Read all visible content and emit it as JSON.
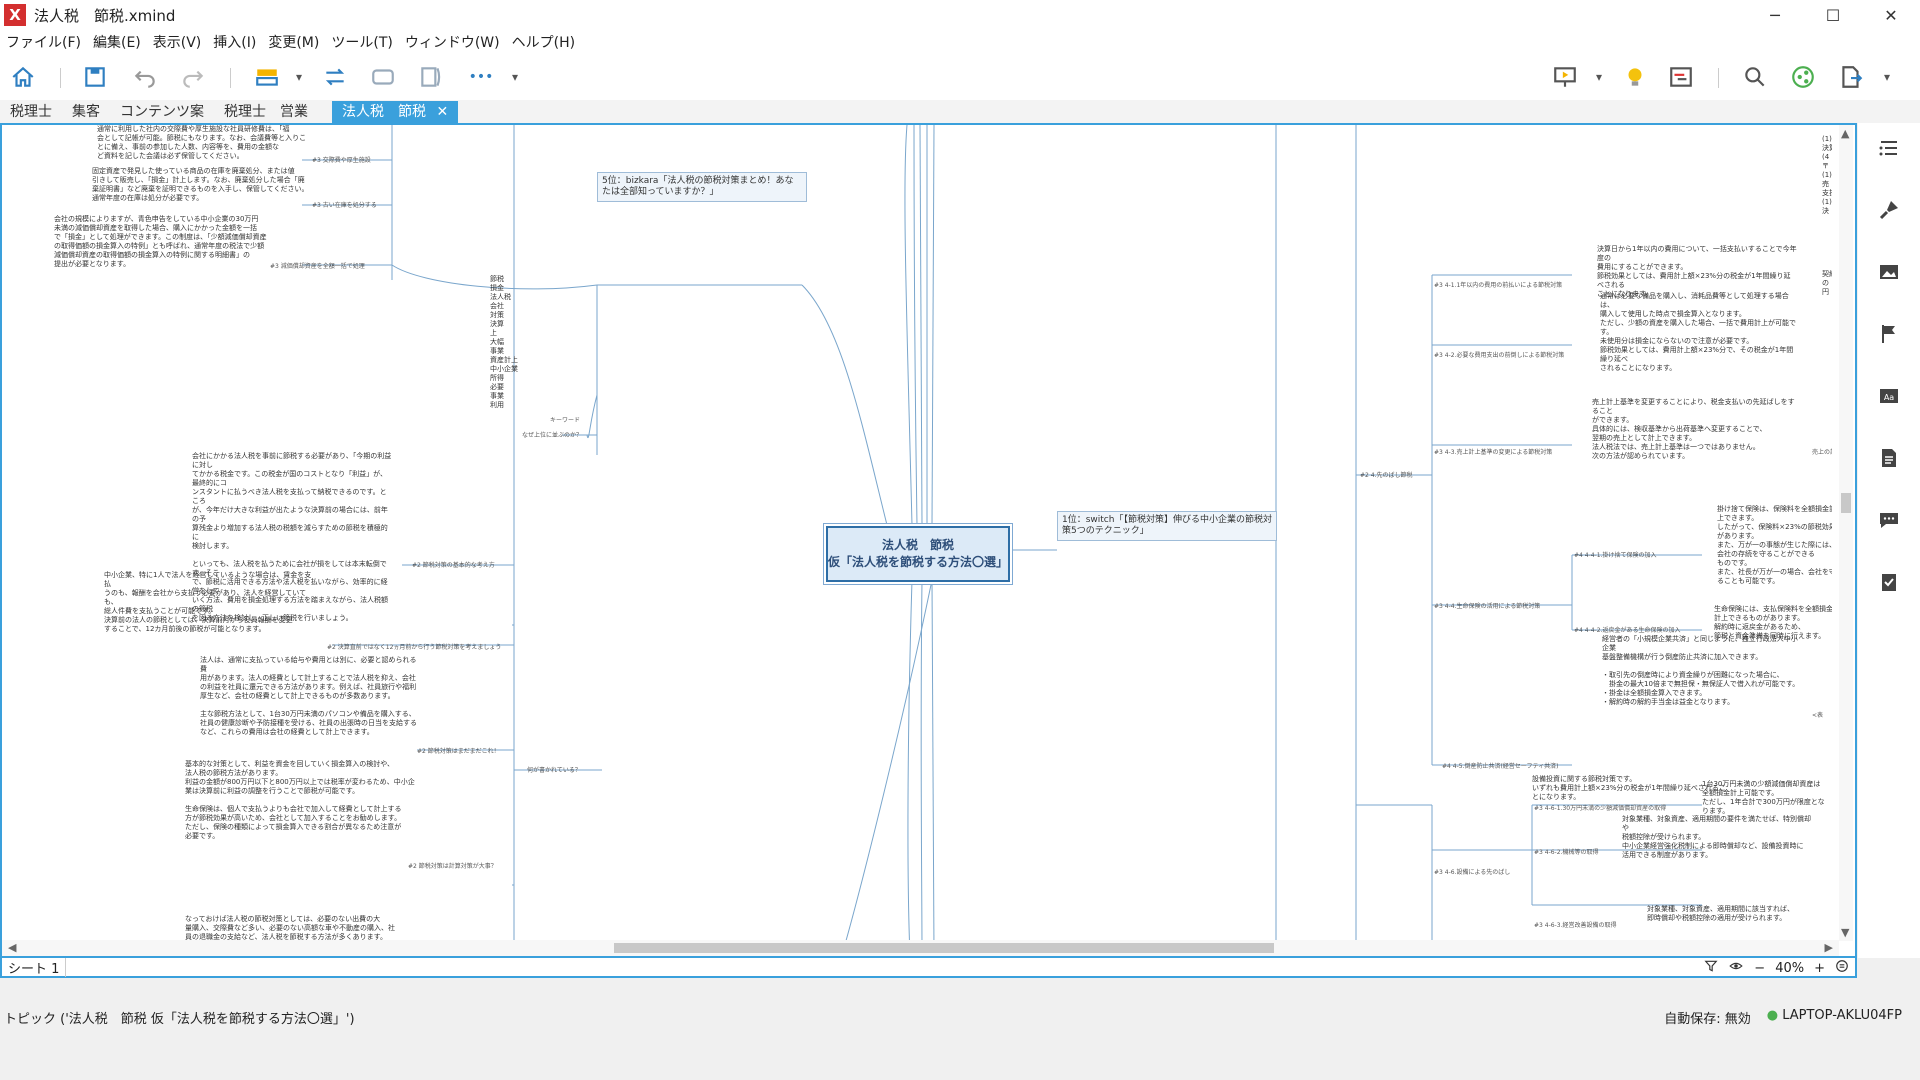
{
  "window": {
    "title": "法人税　節税.xmind",
    "app_icon": "X",
    "minimize": "─",
    "maximize": "☐",
    "close": "✕"
  },
  "menu": [
    "ファイル(F)",
    "編集(E)",
    "表示(V)",
    "挿入(I)",
    "変更(M)",
    "ツール(T)",
    "ウィンドウ(W)",
    "ヘルプ(H)"
  ],
  "toolbar": {
    "more": "•••",
    "dropdown": "▾"
  },
  "tabs": [
    "税理士",
    "集客",
    "コンテンツ案",
    "税理士　営業"
  ],
  "active_tab": "法人税　節税",
  "active_tab_close": "✕",
  "central_topic": {
    "line1": "法人税　節税",
    "line2": "仮「法人税を節税する方法〇選」"
  },
  "topics": {
    "rank5": "5位：bizkara「法人税の節税対策まとめ！あなたは全部知っていますか？」",
    "rank1": "1位：switch「【節税対策】伸びる中小企業の節税対策5つのテクニック」"
  },
  "left_nodes": {
    "n1": "通常に利用した社内の交際費や厚生施設な社員研修費は、「福\n会として記帳が可能。節税にもなります。なお、会議費等と入りこ\nとに備え、事前の参加した人数、内容等を、費用の金額な\nど資料を記した会議は必ず保管してください。",
    "n1_leaf": "#3 交際費や厚生施設",
    "n2": "固定資産で発見した使っている商品の在庫を廃棄処分、または値\n引きして販売し、「損金」計上します。なお、廃棄処分した場合「廃\n棄証明書」など廃棄を証明できるものを入手し、保管してください。\n通常年度の在庫は処分が必要です。",
    "n2_leaf": "#3 古い在庫を処分する",
    "n3": "会社の規模によりますが、青色申告をしている中小企業の30万円\n未満の減価償却資産を取得した場合、購入にかかった金額を一括\nで「損金」として処理ができます。この制度は、「少額減価償却資産\nの取得価額の損金算入の特例」とも呼ばれ、通常年度の税法で少額\n減価償却資産の取得価額の損金算入の特例に関する明細書」の\n提出が必要となります。",
    "n3_leaf": "#3 減価償却資産を全額一括で処理",
    "keywords": "節税\n損金\n法人税\n会社\n対策\n決算\n上\n大幅\n事業\n資産計上\n中小企業\n所得\n必要\n事業\n利用",
    "kw_leaf1": "キーワード",
    "kw_leaf2": "なぜ上位に並ぶのか？",
    "n4": "会社にかかる法人税を事前に節税する必要があり、「今期の利益に対し\nてかかる税金です。この税金が国のコストとなり「利益」が、最終的にコ\nンスタントに払うべき法人税を支払って納税できるのです。ところ\nが、今年だけ大きな利益が出たような決算前の場合には、前年の予\n算残金より増加する法人税の税額を減らすための節税を積極的に\n検討します。\n\nといっても、法人税を払うために会社が損をしては本末転倒です。そこ\nで、節税に活用できる方法や法人税を払いながら、効率的に経営をして\nいく方法、費用を損金処理する方法を踏まえながら、法人税額の節税\nを図る方法を検討し、正しい節税を行いましょう。",
    "n4_leaf": "#2 節税対策の基本的な考え方",
    "n5": "中小企業、特に1人で法人を経営しているような場合は、賃金を支払\nうのも、報酬を会社から支払う必要があり、法人を経営していても、\n総人件費を支払うことが可能です。\n決算前の法人の節税としては、決算前月から役員報酬を変更\nすることで、12カ月前後の節税が可能となります。",
    "n5_leaf": "#2 決算直前ではなく12ヵ月前から行う節税対策を考えましょう",
    "n6": "法人は、通常に支払っている給与や費用とは別に、必要と認められる費\n用があります。法人の経費として計上することで法人税を抑え、会社\nの利益を社員に還元できる方法があります。例えば、社員旅行や福利\n厚生など、会社の経費として計上できるものが多数あります。\n\n主な節税方法として、1台30万円未満のパソコンや備品を購入する、\n社員の健康診断や予防接種を受ける、社員の出張時の日当を支給する\nなど、これらの費用は会社の経費として計上できます。",
    "n6_leaf": "#2 節税対策はまだまだこれ！",
    "n7": "基本的な対策として、利益を資金を回していく損金算入の検討や、\n法人税の節税方法があります。\n利益の金額が800万円以下と800万円以上では税率が変わるため、中小企\n業は決算前に利益の調整を行うことで節税が可能です。\n\n生命保険は、個人で支払うよりも会社で加入して経費として計上する\n方が節税効果が高いため、会社として加入することをお勧めします。\nただし、保険の種類によって損金算入できる割合が異なるため注意が\n必要です。",
    "n7_leaf": "#2 節税対策は計算対策が大事？",
    "n7_leaf2": "何が書かれている？",
    "n8": "なっておけば法人税の節税対策としては、必要のない出費の大\n量購入、交際費など多い、必要のない高額な車や不動産の購入、社\n員の退職金の支給など、法人税を節税する方法が多くあります。"
  },
  "right_nodes": {
    "r1": "決算日から1年以内の費用について、一括支払いすることで今年度の\n費用にすることができます。\n節税効果としては、費用計上額×23%分の税金が1年間繰り延べされる\nことになります。",
    "r1_leaf": "#3 4-1.1年以内の費用の前払いによる節税対策",
    "r2": "通常は必要な備品を購入し、消耗品費等として処理する場合は、\n購入して使用した時点で損金算入となります。\nただし、少額の資産を購入した場合、一括で費用計上が可能です。\n未使用分は損金にならないので注意が必要です。\n節税効果としては、費用計上額×23%分で、その税金が1年間繰り延べ\nされることになります。",
    "r2_leaf": "#3 4-2.必要な費用支出の前倒しによる節税対策",
    "r3": "売上計上基準を変更することにより、税金支払いの先延ばしをすること\nができます。\n具体的には、検収基準から出荷基準へ変更することで、\n翌期の売上として計上できます。\n法人税法では、売上計上基準は一つではありません。\n次の方法が認められています。",
    "r3_leaf": "#3 4-3.売上計上基準の変更による節税対策",
    "r3_side": "売上の計",
    "r_main_leaf": "#2 4.先のばし節税",
    "r4": "掛け捨て保険は、保険料を全額損金計上できます。\nしたがって、保険料×23%の節税効果があります。\nまた、万が一の事態が生じた際には、会社の存続を守ることができる\nものです。\nまた、社長が万が一の場合、会社を守ることも可能です。",
    "r4_leaf": "#4 4-4-1.掛け捨て保険の加入",
    "r4b": "生命保険には、支払保険料を全額損金計上できるものがあります。\n解約時に返戻金があるため、\n節税と資金準備を同時に行えます。",
    "r4b_leaf": "#4 4-4-2.返戻金がある生命保険の加入",
    "r4_main_leaf": "#3 4-4.生命保険の活用による節税対策",
    "r5": "経営者の「小規模企業共済」と同じように、独立行政法人中小企業\n基盤整備機構が行う倒産防止共済に加入できます。\n\n・取引先の倒産時により資金繰りが困難になった場合に、\n　掛金の最大10倍まで無担保・無保証人で借入れが可能です。\n・掛金は全額損金算入できます。\n・解約時の解約手当金は益金となります。",
    "r5_leaf": "#4 4-5.倒産防止共済(経営セーフティ共済)",
    "r5_side": "<表",
    "r6": "設備投資に関する節税対策です。\nいずれも費用計上額×23%分の税金が1年間繰り延べされるこ\nとになります。",
    "r6a": "1台30万円未満の少額減価償却資産は全額損金計上可能です。\nただし、1年合計で300万円が限度となります。",
    "r6a_leaf": "#3 4-6-1.30万円未満の少額減価償却資産の取得",
    "r6b": "対象業種、対象資産、適用期間の要件を満たせば、特別償却や\n税額控除が受けられます。\n中小企業経営強化税制による即時償却など、設備投資時に\n活用できる制度があります。",
    "r6b_leaf": "#3 4-6-2.機械等の取得",
    "r6c": "対象業種、対象資産、適用期間に該当すれば、\n即時償却や税額控除の適用が受けられます。",
    "r6c_leaf": "#3 4-6-3.経営改善設備の取得",
    "r6_main_leaf": "#3 4-6.設備による先のばし",
    "far_right": "(1)\n決算\n(4\n〒\n(1)\n売\n支払\n(1)\n決\n\n\n\n\n\n\n契約\nの\n円"
  },
  "sheet": {
    "name": "シート 1",
    "zoom": "40%",
    "minus": "−",
    "plus": "+"
  },
  "status": {
    "topic": "トピック ('法人税　節税 仮「法人税を節税する方法〇選」')",
    "autosave": "自動保存: 無効",
    "computer": "LAPTOP-AKLU04FP"
  }
}
